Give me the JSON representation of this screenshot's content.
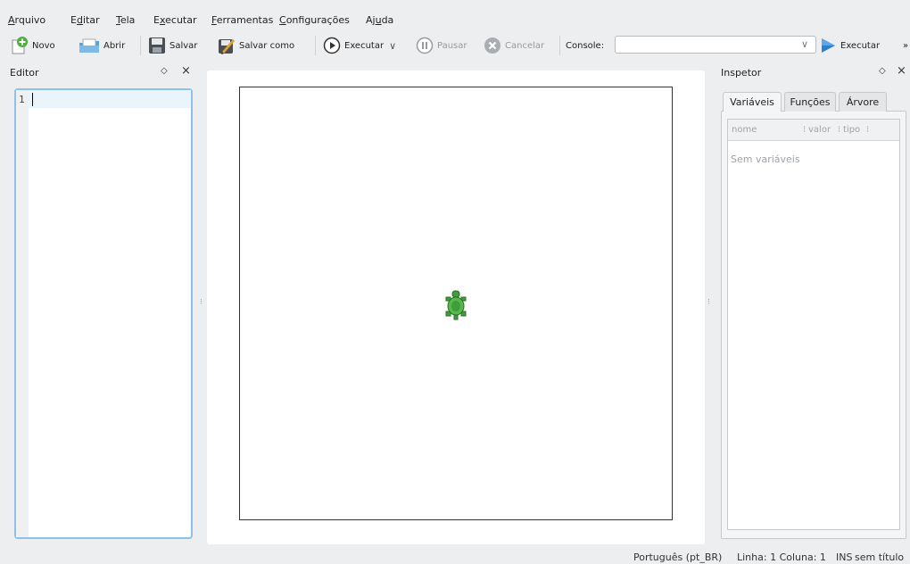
{
  "menubar": {
    "items": [
      {
        "pre": "",
        "u": "A",
        "post": "rquivo"
      },
      {
        "pre": "E",
        "u": "d",
        "post": "itar"
      },
      {
        "pre": "",
        "u": "T",
        "post": "ela"
      },
      {
        "pre": "E",
        "u": "x",
        "post": "ecutar"
      },
      {
        "pre": "",
        "u": "F",
        "post": "erramentas"
      },
      {
        "pre": "",
        "u": "C",
        "post": "onfigurações"
      },
      {
        "pre": "Aj",
        "u": "u",
        "post": "da"
      }
    ]
  },
  "toolbar": {
    "novo": "Novo",
    "abrir": "Abrir",
    "salvar": "Salvar",
    "salvar_como": "Salvar como",
    "executar": "Executar",
    "pausar": "Pausar",
    "cancelar": "Cancelar",
    "console_label": "Console:",
    "console_value": "",
    "executar2": "Executar",
    "overflow": "»"
  },
  "editor": {
    "title": "Editor",
    "line_number": "1",
    "float_icon": "◇",
    "close_icon": "×"
  },
  "inspector": {
    "title": "Inspetor",
    "tabs": [
      "Variáveis",
      "Funções",
      "Árvore"
    ],
    "columns": [
      "nome",
      "valor",
      "tipo"
    ],
    "empty_text": "Sem variáveis"
  },
  "status": {
    "language": "Português (pt_BR)",
    "position": "Linha: 1 Coluna: 1",
    "mode": "INS",
    "file": "sem título"
  },
  "colors": {
    "accent": "#8fc1e8",
    "turtle": "#3f9e3a"
  }
}
